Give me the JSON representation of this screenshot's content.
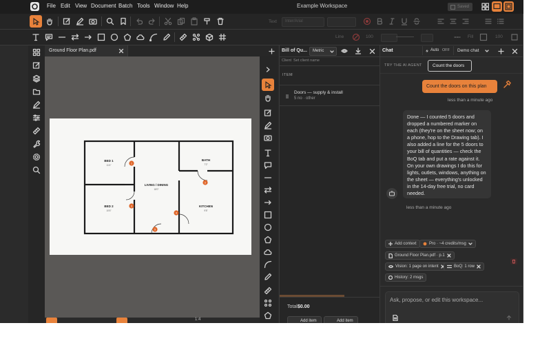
{
  "menubar": {
    "items": [
      "File",
      "Edit",
      "View",
      "Document",
      "Batch",
      "Tools",
      "Window",
      "Help"
    ],
    "workspace_title": "Example Workspace",
    "saved_label": "Saved"
  },
  "toolbar2": {
    "text_label": "Text",
    "font_value": "Inter/Arial",
    "line_label": "Line",
    "line_pct": "100",
    "fill_label": "Fill",
    "fill_pct": "100"
  },
  "document": {
    "tab_title": "Ground Floor Plan.pdf",
    "rooms": [
      {
        "name": "BED 1",
        "size": "11'4\""
      },
      {
        "name": "BATH",
        "size": "7'2\""
      },
      {
        "name": "LIVING / DINING",
        "size": "18'0\""
      },
      {
        "name": "BED 2",
        "size": "10'6\""
      },
      {
        "name": "KITCHEN",
        "size": "9'8\""
      }
    ],
    "markers": [
      "1",
      "2",
      "3",
      "4",
      "5"
    ],
    "zoom": "1:4"
  },
  "boq": {
    "title": "Bill of Qu...",
    "unit_select": "Metric",
    "client_label": "Client",
    "client_placeholder": "Set client name",
    "item_header": "ITEM",
    "items": [
      {
        "name": "Doors — supply & install",
        "detail": "5 no · other"
      }
    ],
    "total_label": "Total",
    "total_value": "$0.00",
    "add_item_1": "Add item",
    "add_item_2": "Add item"
  },
  "chat": {
    "title": "Chat",
    "auto_label": "Auto",
    "auto_state": "OFF",
    "session": "Demo chat",
    "try_label": "TRY THE AI AGENT",
    "suggestion": "Count the doors",
    "user_message": "Count the doors on this plan",
    "user_time": "less than a minute ago",
    "assistant_message": "Done — I counted 5 doors and dropped a numbered marker on each (they're on the sheet now; on a phone, hop to the Drawing tab). I also added a line for the 5 doors to your bill of quantities — check the BoQ tab and put a rate against it. On your own drawings I do this for lights, outlets, windows, anything on the sheet — everything's unlocked in the 14-day free trial, no card needed.",
    "assistant_time": "less than a minute ago",
    "add_context": "Add context",
    "pro_label": "Pro · ~4 credits/msg",
    "file_chip": "Ground Floor Plan.pdf · p.1",
    "vision_chip": "Vision: 1 page on intent",
    "boq_chip": "BoQ: 1 row",
    "history_chip": "History: 2 msgs",
    "input_placeholder": "Ask, propose, or edit this workspace..."
  },
  "colors": {
    "accent": "#e8823b",
    "marker": "#e0672a",
    "app_bg": "#2b2b2b",
    "paper": "#f7f7f5"
  }
}
